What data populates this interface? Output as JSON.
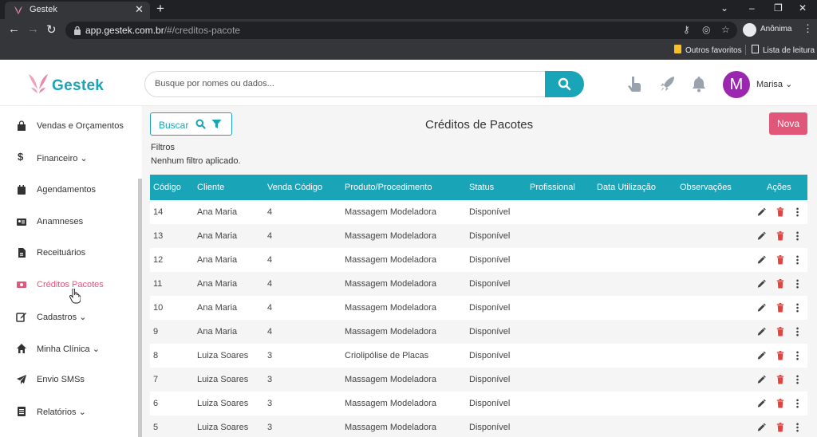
{
  "browser": {
    "tab_title": "Gestek",
    "url_domain": "app.gestek.com.br",
    "url_path": "/#/creditos-pacote",
    "profile_label": "Anônima",
    "bookmarks": [
      {
        "label": "Outros favoritos",
        "icon": "folder-icon"
      },
      {
        "label": "Lista de leitura",
        "icon": "reading-list-icon"
      }
    ]
  },
  "header": {
    "logo_text": "Gestek",
    "search_placeholder": "Busque por nomes ou dados...",
    "user_initial": "M",
    "user_name": "Marisa",
    "colors": {
      "brand": "#1aa4b8",
      "accent": "#e0577a",
      "avatar": "#9b27b0"
    }
  },
  "sidebar": {
    "items": [
      {
        "label": "Vendas e Orçamentos",
        "icon": "shopping-bag-icon",
        "dropdown": false,
        "active": false
      },
      {
        "label": "Financeiro",
        "icon": "dollar-icon",
        "dropdown": true,
        "active": false
      },
      {
        "label": "Agendamentos",
        "icon": "calendar-icon",
        "dropdown": false,
        "active": false
      },
      {
        "label": "Anamneses",
        "icon": "id-card-icon",
        "dropdown": false,
        "active": false
      },
      {
        "label": "Receituários",
        "icon": "document-icon",
        "dropdown": false,
        "active": false
      },
      {
        "label": "Créditos Pacotes",
        "icon": "money-bill-icon",
        "dropdown": false,
        "active": true
      },
      {
        "label": "Cadastros",
        "icon": "edit-icon",
        "dropdown": true,
        "active": false
      },
      {
        "label": "Minha Clínica",
        "icon": "home-icon",
        "dropdown": true,
        "active": false
      },
      {
        "label": "Envio SMSs",
        "icon": "send-icon",
        "dropdown": false,
        "active": false
      },
      {
        "label": "Relatórios",
        "icon": "report-icon",
        "dropdown": true,
        "active": false
      }
    ]
  },
  "main": {
    "buscar_label": "Buscar",
    "page_title": "Créditos de Pacotes",
    "nova_label": "Nova",
    "filters_title": "Filtros",
    "filters_text": "Nenhum filtro aplicado.",
    "columns": [
      "Código",
      "Cliente",
      "Venda Código",
      "Produto/Procedimento",
      "Status",
      "Profissional",
      "Data Utilização",
      "Observações",
      "Ações"
    ],
    "rows": [
      {
        "codigo": "14",
        "cliente": "Ana Maria",
        "venda": "4",
        "produto": "Massagem Modeladora",
        "status": "Disponível",
        "profissional": "",
        "data": "",
        "obs": ""
      },
      {
        "codigo": "13",
        "cliente": "Ana Maria",
        "venda": "4",
        "produto": "Massagem Modeladora",
        "status": "Disponível",
        "profissional": "",
        "data": "",
        "obs": ""
      },
      {
        "codigo": "12",
        "cliente": "Ana Maria",
        "venda": "4",
        "produto": "Massagem Modeladora",
        "status": "Disponível",
        "profissional": "",
        "data": "",
        "obs": ""
      },
      {
        "codigo": "11",
        "cliente": "Ana Maria",
        "venda": "4",
        "produto": "Massagem Modeladora",
        "status": "Disponível",
        "profissional": "",
        "data": "",
        "obs": ""
      },
      {
        "codigo": "10",
        "cliente": "Ana Maria",
        "venda": "4",
        "produto": "Massagem Modeladora",
        "status": "Disponível",
        "profissional": "",
        "data": "",
        "obs": ""
      },
      {
        "codigo": "9",
        "cliente": "Ana Maria",
        "venda": "4",
        "produto": "Massagem Modeladora",
        "status": "Disponível",
        "profissional": "",
        "data": "",
        "obs": ""
      },
      {
        "codigo": "8",
        "cliente": "Luiza Soares",
        "venda": "3",
        "produto": "Criolipólise de Placas",
        "status": "Disponível",
        "profissional": "",
        "data": "",
        "obs": ""
      },
      {
        "codigo": "7",
        "cliente": "Luiza Soares",
        "venda": "3",
        "produto": "Massagem Modeladora",
        "status": "Disponível",
        "profissional": "",
        "data": "",
        "obs": ""
      },
      {
        "codigo": "6",
        "cliente": "Luiza Soares",
        "venda": "3",
        "produto": "Massagem Modeladora",
        "status": "Disponível",
        "profissional": "",
        "data": "",
        "obs": ""
      },
      {
        "codigo": "5",
        "cliente": "Luiza Soares",
        "venda": "3",
        "produto": "Massagem Modeladora",
        "status": "Disponível",
        "profissional": "",
        "data": "",
        "obs": ""
      }
    ]
  }
}
